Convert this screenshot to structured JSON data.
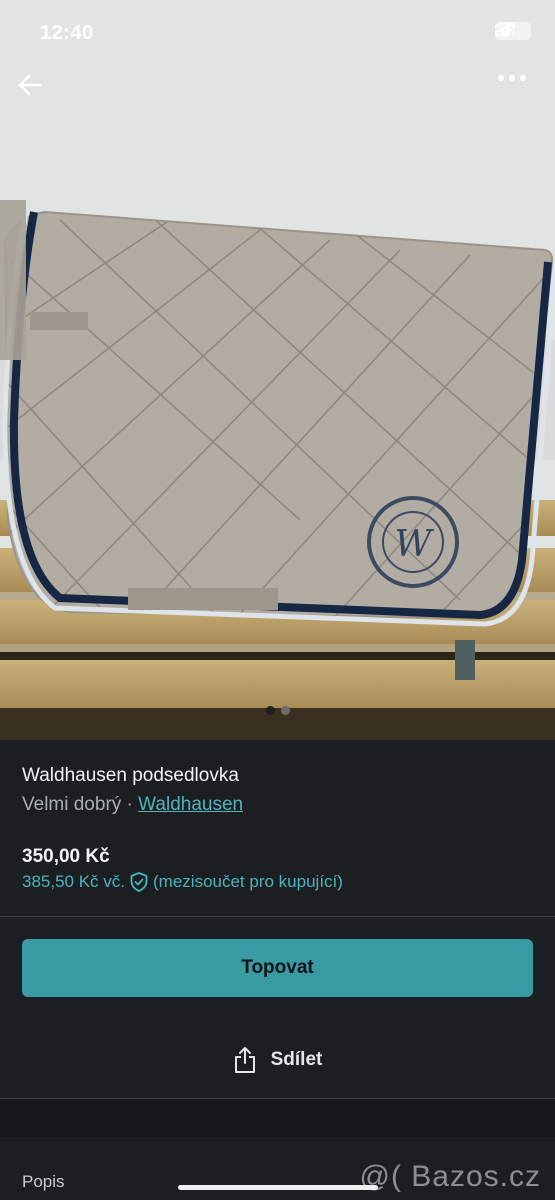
{
  "status": {
    "time": "12:40",
    "battery": "43"
  },
  "nav": {
    "back_icon": "arrow-left-icon",
    "more_icon": "more-dots-icon"
  },
  "gallery": {
    "count": 2,
    "active": 0
  },
  "product": {
    "title": "Waldhausen podsedlovka",
    "condition": "Velmi dobrý",
    "separator": " · ",
    "brand": "Waldhausen",
    "price": "350,00 Kč",
    "buyer_price": "385,50 Kč vč.",
    "buyer_note": "(mezisoučet pro kupující)"
  },
  "actions": {
    "promote_label": "Topovat",
    "share_label": "Sdílet"
  },
  "section": {
    "description_label": "Popis"
  },
  "watermark": "@( Bazos.cz",
  "colors": {
    "accent": "#4db4bc",
    "button": "#3a9aa3",
    "background": "#1b1f21"
  }
}
